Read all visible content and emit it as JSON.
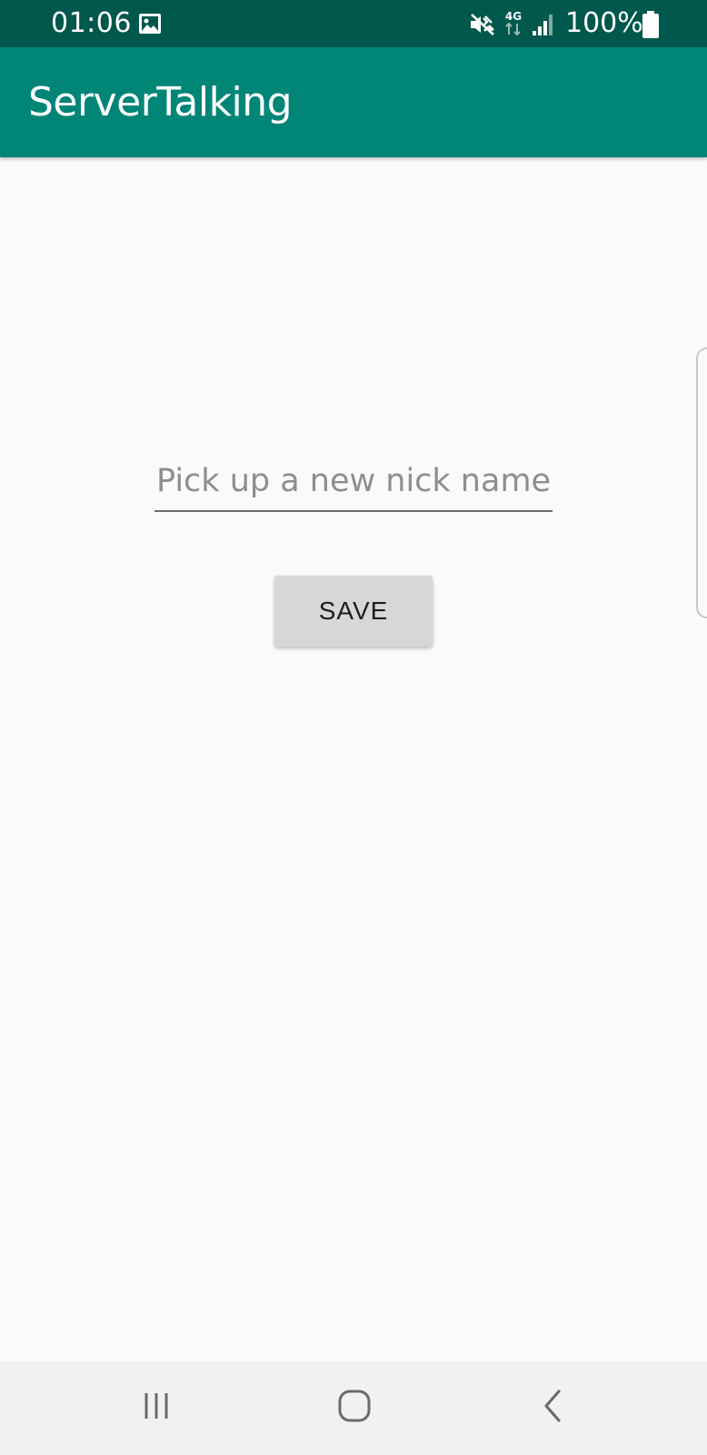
{
  "status_bar": {
    "time": "01:06",
    "battery_percent": "100%",
    "network_type": "4G",
    "icons": [
      "gallery-icon",
      "mute-icon",
      "4g-icon",
      "signal-icon",
      "battery-icon"
    ]
  },
  "app_bar": {
    "title": "ServerTalking"
  },
  "form": {
    "nickname": {
      "placeholder": "Pick up a new nick name",
      "value": ""
    },
    "save_label": "SAVE"
  },
  "nav_bar": {
    "icons": [
      "recents-icon",
      "home-icon",
      "back-icon"
    ]
  },
  "colors": {
    "status_bar": "#00574b",
    "app_bar": "#008577",
    "background": "#fafafa",
    "button": "#d6d7d7",
    "nav_bar": "#f1f1f1"
  }
}
